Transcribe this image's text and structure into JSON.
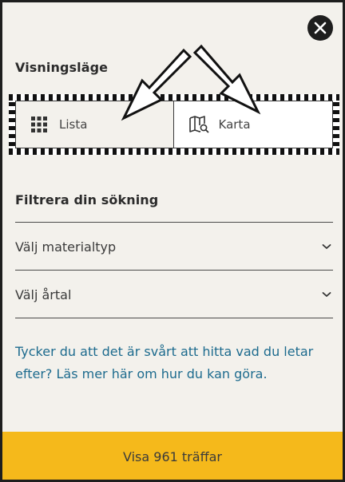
{
  "view_mode": {
    "title": "Visningsläge",
    "options": [
      {
        "label": "Lista",
        "icon": "grid-icon",
        "selected": false
      },
      {
        "label": "Karta",
        "icon": "map-search-icon",
        "selected": true
      }
    ]
  },
  "filters": {
    "title": "Filtrera din sökning",
    "dropdowns": [
      {
        "label": "Välj materialtyp"
      },
      {
        "label": "Välj årtal"
      }
    ]
  },
  "info_link": "Tycker du att det är svårt att hitta vad du letar efter? Läs mer här om hur du kan göra.",
  "submit": {
    "label": "Visa 961 träffar"
  },
  "colors": {
    "panel_background": "#f3f1ec",
    "accent_yellow": "#f5b91b",
    "link_blue": "#1d6b8e",
    "close_button": "#1e1e1e"
  }
}
